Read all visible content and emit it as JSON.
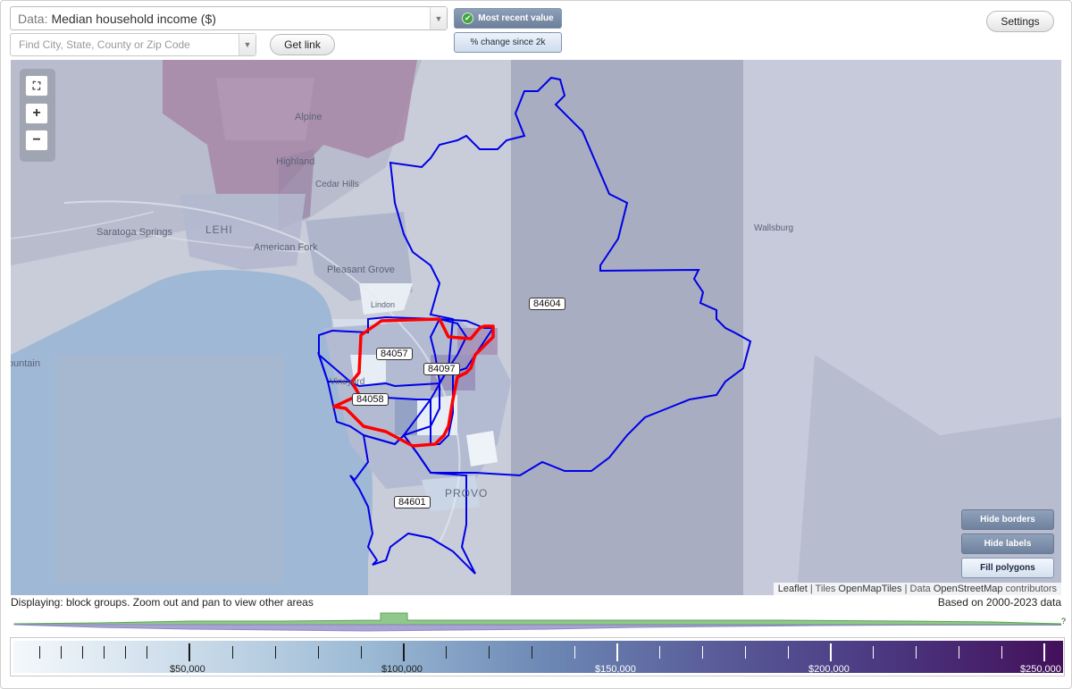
{
  "controls": {
    "data_prefix": "Data:",
    "data_value": "Median household income ($)",
    "search_placeholder": "Find City, State, County or Zip Code",
    "get_link": "Get link",
    "toggle_recent": "Most recent value",
    "toggle_change": "% change since 2k",
    "settings": "Settings"
  },
  "map": {
    "place_labels": [
      "Alpine",
      "Highland",
      "Cedar Hills",
      "LEHI",
      "Saratoga Springs",
      "American Fork",
      "Pleasant Grove",
      "Lindon",
      "Vineyard",
      "PROVO",
      "Wallsburg",
      "Mountain"
    ],
    "zip_labels": [
      "84604",
      "84057",
      "84097",
      "84058",
      "84601"
    ],
    "hide_borders": "Hide borders",
    "hide_labels": "Hide labels",
    "fill_polygons": "Fill polygons",
    "attribution": {
      "leaflet": "Leaflet",
      "sep1": " | Tiles ",
      "tiles": "OpenMapTiles",
      "sep2": " | Data ",
      "data": "OpenStreetMap",
      "suffix": " contributors"
    }
  },
  "status": {
    "displaying": "Displaying: block groups. Zoom out and pan to view other areas",
    "based_on": "Based on 2000-2023 data"
  },
  "histogram": {
    "question_mark": "?"
  },
  "legend": {
    "labels": [
      "$50,000",
      "$100,000",
      "$150,000",
      "$200,000",
      "$250,000"
    ],
    "colors": {
      "low": "#f4f8fc",
      "mid": "#6e8ab6",
      "high": "#43105a"
    }
  },
  "colors": {
    "zip_border": "#0000e6",
    "selected_border": "#ff0000",
    "button_accent": "#6c7f99"
  }
}
